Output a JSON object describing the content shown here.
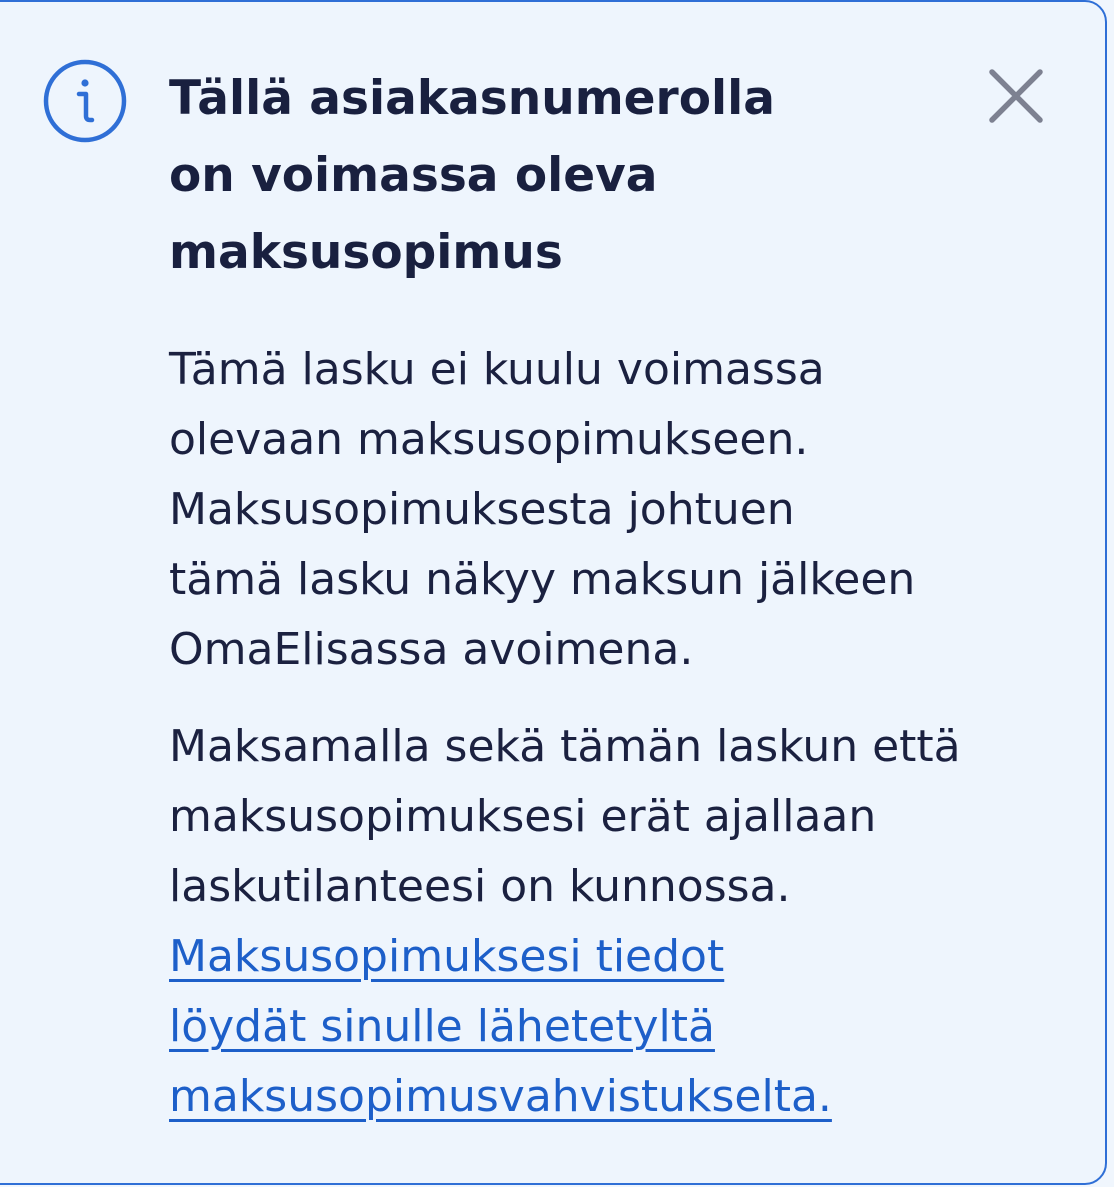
{
  "notice": {
    "icons": {
      "info": "info-circle-icon",
      "close": "close-x-icon"
    },
    "title_lines": [
      "Tällä asiakasnumerolla",
      "on voimassa oleva",
      "maksusopimus"
    ],
    "paragraph1_lines": [
      "Tämä lasku ei kuulu voimassa",
      "olevaan maksusopimukseen.",
      "Maksusopimuksesta johtuen",
      "tämä lasku näkyy maksun jälkeen",
      "OmaElisassa avoimena."
    ],
    "paragraph2_lines": [
      "Maksamalla sekä tämän laskun että",
      "maksusopimuksesi erät ajallaan",
      "laskutilanteesi on kunnossa."
    ],
    "link_lines": [
      "Maksusopimuksesi tiedot",
      "löydät sinulle lähetetyltä",
      "maksusopimusvahvistukselta."
    ],
    "colors": {
      "background": "#eef5fd",
      "border": "#2f6fd6",
      "icon": "#2f6fd6",
      "title": "#19203f",
      "text": "#1b2140",
      "link": "#1d5fc9",
      "close": "#7d8191"
    }
  }
}
